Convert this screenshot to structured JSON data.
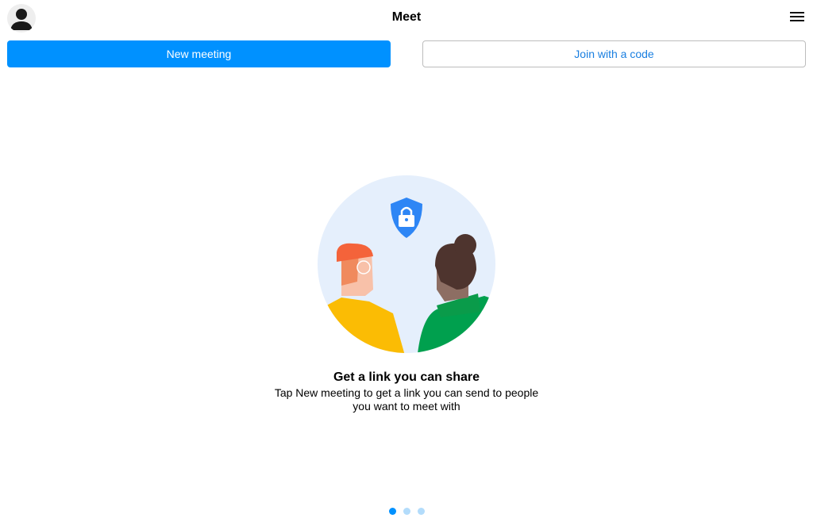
{
  "header": {
    "title": "Meet",
    "avatar_icon": "user-avatar-icon",
    "menu_icon": "hamburger-menu-icon"
  },
  "actions": {
    "new_meeting": "New meeting",
    "join_code": "Join with a code"
  },
  "onboarding": {
    "heading": "Get a link you can share",
    "description": "Tap New meeting to get a link you can send to people you want to meet with",
    "illustration_icon": "shield-lock-icon"
  },
  "pager": {
    "total": 3,
    "active": 1
  },
  "colors": {
    "accent": "#0091ff",
    "dot_inactive": "#b3dcfb"
  }
}
